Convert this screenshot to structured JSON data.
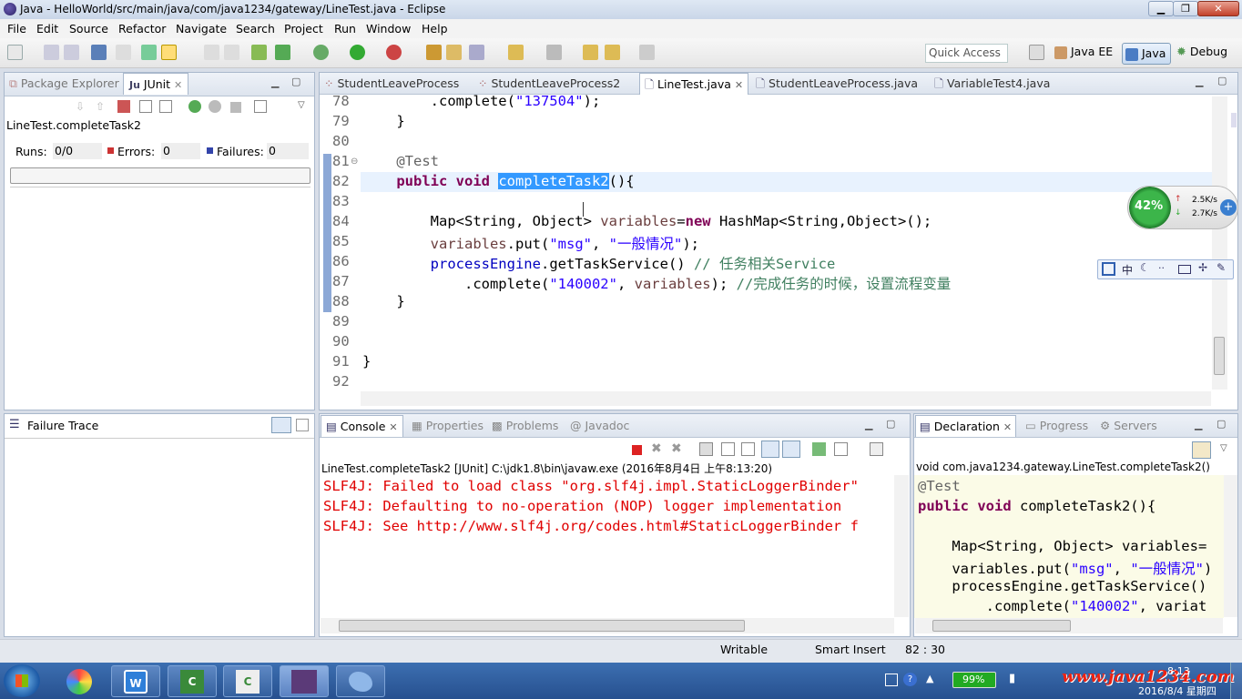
{
  "window": {
    "title": "Java - HelloWorld/src/main/java/com/java1234/gateway/LineTest.java - Eclipse",
    "minimize": "▁",
    "restore": "❐",
    "close": "✕"
  },
  "menu": [
    "File",
    "Edit",
    "Source",
    "Refactor",
    "Navigate",
    "Search",
    "Project",
    "Run",
    "Window",
    "Help"
  ],
  "toolbar": {
    "quick_access": "Quick Access",
    "perspectives": [
      "Java EE",
      "Java",
      "Debug"
    ]
  },
  "left_panel": {
    "tabs": [
      "Package Explorer",
      "JUnit"
    ],
    "test_name": "LineTest.completeTask2",
    "runs_label": "Runs:",
    "runs_value": "0/0",
    "errors_label": "Errors:",
    "errors_value": "0",
    "failures_label": "Failures:",
    "failures_value": "0",
    "failure_trace": "Failure Trace"
  },
  "editor": {
    "tabs": [
      "StudentLeaveProcess",
      "StudentLeaveProcess2",
      "LineTest.java",
      "StudentLeaveProcess.java",
      "VariableTest4.java"
    ],
    "line_numbers": [
      "78",
      "79",
      "80",
      "81",
      "82",
      "83",
      "84",
      "85",
      "86",
      "87",
      "88",
      "89",
      "90",
      "91",
      "92"
    ],
    "lines": {
      "l78a": "        .complete(",
      "l78b": "\"137504\"",
      "l78c": ");",
      "l79": "    }",
      "l81": "    @Test",
      "l82a": "    public void ",
      "l82b": "completeTask2",
      "l82c": "(){",
      "l84a": "        Map<String, Object> ",
      "l84b": "variables",
      "l84c": "=",
      "l84d": "new",
      "l84e": " HashMap<String,Object>();",
      "l85a": "        ",
      "l85b": "variables",
      "l85c": ".put(",
      "l85d": "\"msg\"",
      "l85e": ", ",
      "l85f": "\"一般情况\"",
      "l85g": ");",
      "l86a": "        ",
      "l86b": "processEngine",
      "l86c": ".getTaskService() ",
      "l86d": "// 任务相关Service",
      "l87a": "            .complete(",
      "l87b": "\"140002\"",
      "l87c": ", ",
      "l87d": "variables",
      "l87e": "); ",
      "l87f": "//完成任务的时候，设置流程变量",
      "l88": "    }",
      "l91": "}"
    }
  },
  "net_widget": {
    "percent": "42%",
    "up": "2.5K/s",
    "down": "2.7K/s"
  },
  "ime_bar": "中",
  "console": {
    "tabs": [
      "Console",
      "Properties",
      "Problems",
      "Javadoc"
    ],
    "header": "LineTest.completeTask2 [JUnit] C:\\jdk1.8\\bin\\javaw.exe (2016年8月4日 上午8:13:20)",
    "lines": [
      "SLF4J: Failed to load class \"org.slf4j.impl.StaticLoggerBinder\"",
      "SLF4J: Defaulting to no-operation (NOP) logger implementation",
      "SLF4J: See http://www.slf4j.org/codes.html#StaticLoggerBinder f"
    ]
  },
  "declaration": {
    "tabs": [
      "Declaration",
      "Progress",
      "Servers"
    ],
    "header": "void com.java1234.gateway.LineTest.completeTask2()",
    "d1": "@Test",
    "d2a": "public void ",
    "d2b": "completeTask2(){",
    "d4a": "    Map<String, Object> ",
    "d4b": "variables=",
    "d5a": "    variables.put(",
    "d5b": "\"msg\"",
    "d5c": ", ",
    "d5d": "\"一般情况\"",
    "d5e": ")",
    "d6a": "    processEngine.getTaskService()",
    "d7a": "        .complete(",
    "d7b": "\"140002\"",
    "d7c": ", variat"
  },
  "status": {
    "writable": "Writable",
    "insert": "Smart Insert",
    "position": "82 : 30"
  },
  "taskbar": {
    "battery": "99%",
    "watermark": "www.java1234.com",
    "date": "2016/8/4 星期四",
    "time": "8:13"
  },
  "colors": {
    "keyword": "#7f0055",
    "string": "#2a00ff",
    "comment": "#3f7f5f",
    "field": "#0000c0",
    "error": "#e00000",
    "selection": "#3399ff"
  }
}
